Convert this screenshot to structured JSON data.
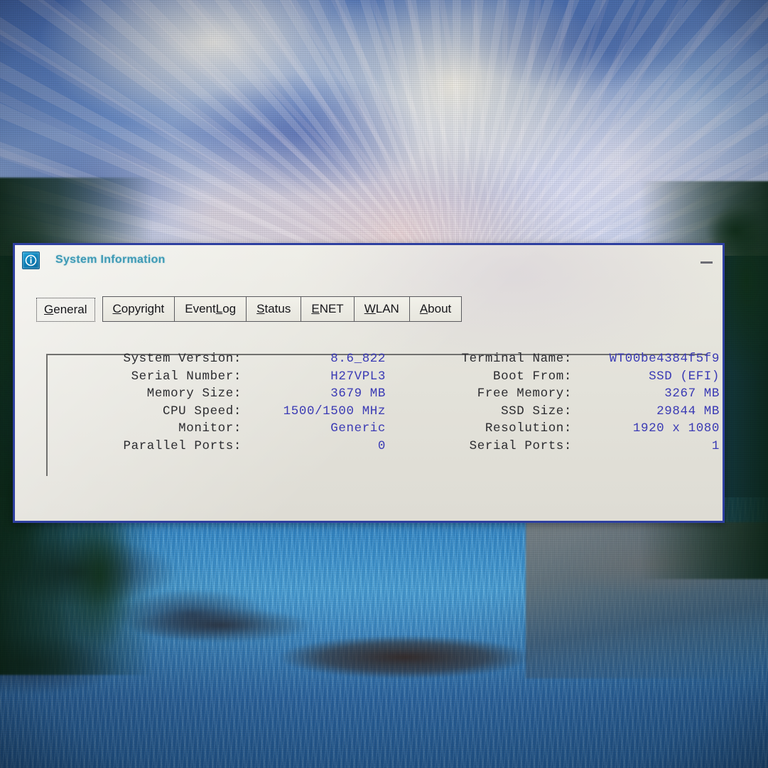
{
  "desktop": {
    "wallpaper_description": "Photo of a monitor showing a nature wallpaper: iridescent pink and blue clouds over a turquoise mountain river with rocky banks and evergreen forest",
    "sky_color": "#6f95d6",
    "river_color": "#3a93cf",
    "forest_color": "#12401a"
  },
  "window": {
    "title": "System Information",
    "icon": "info-icon",
    "title_color": "#3f9ab5",
    "border_color": "#2e3fa0",
    "surface_color": "#e6e6de",
    "minimize_label": "",
    "minimize_tooltip": "Minimize"
  },
  "tabs": [
    {
      "label": "General",
      "mnemonic": "G",
      "before": "",
      "after": "eneral",
      "selected": true
    },
    {
      "label": "Copyright",
      "mnemonic": "C",
      "before": "",
      "after": "opyright",
      "selected": false
    },
    {
      "label": "Event Log",
      "mnemonic": "L",
      "before": "Event ",
      "after": "og",
      "selected": false
    },
    {
      "label": "Status",
      "mnemonic": "S",
      "before": "",
      "after": "tatus",
      "selected": false
    },
    {
      "label": "ENET",
      "mnemonic": "E",
      "before": "",
      "after": "NET",
      "selected": false
    },
    {
      "label": "WLAN",
      "mnemonic": "W",
      "before": "",
      "after": "LAN",
      "selected": false
    },
    {
      "label": "About",
      "mnemonic": "A",
      "before": "",
      "after": "bout",
      "selected": false
    }
  ],
  "general": {
    "label_color": "#2c2c30",
    "value_color": "#3a3ab4",
    "left_column": [
      {
        "label": "System Version:",
        "value": "8.6_822"
      },
      {
        "label": "Serial Number:",
        "value": "H27VPL3"
      },
      {
        "label": "Memory Size:",
        "value": "3679 MB"
      },
      {
        "label": "CPU Speed:",
        "value": "1500/1500 MHz"
      },
      {
        "label": "Monitor:",
        "value": "Generic"
      },
      {
        "label": "Parallel Ports:",
        "value": "0"
      }
    ],
    "right_column": [
      {
        "label": "Terminal Name:",
        "value": "WT00be4384f5f9"
      },
      {
        "label": "Boot From:",
        "value": "SSD (EFI)"
      },
      {
        "label": "Free Memory:",
        "value": "3267 MB"
      },
      {
        "label": "SSD Size:",
        "value": "29844 MB"
      },
      {
        "label": "Resolution:",
        "value": "1920 x 1080"
      },
      {
        "label": "Serial Ports:",
        "value": "1"
      }
    ]
  }
}
